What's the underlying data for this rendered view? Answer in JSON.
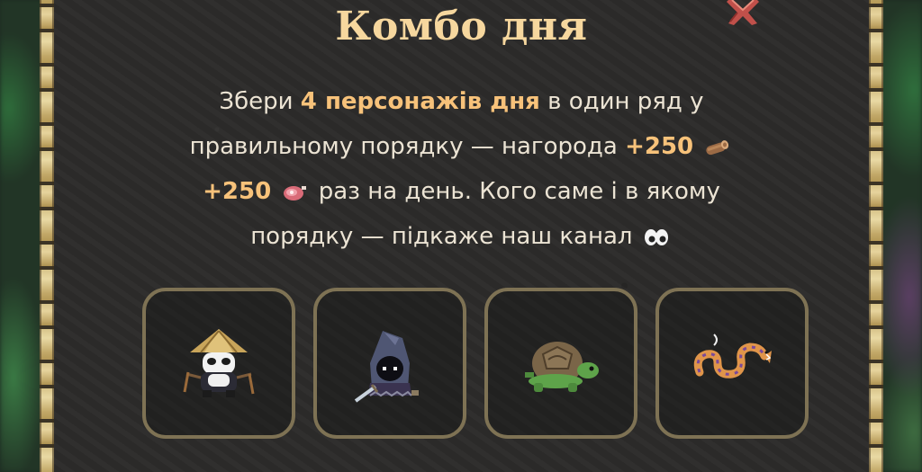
{
  "popup": {
    "title": "Комбо дня",
    "description": {
      "line1_a": "Збери",
      "line1_hl": "4 персонажів дня",
      "line1_b": "в один ряд у",
      "line2_a": "правильному порядку — нагорода",
      "reward1": "+250",
      "reward1_icon": "log-icon",
      "reward2": "+250",
      "reward2_icon": "meat-icon",
      "line3_b": "раз на день. Кого саме і в якому",
      "line4": "порядку — підкаже наш канал",
      "line4_icon": "eyes-icon"
    },
    "characters": [
      {
        "icon": "panda-monk-icon"
      },
      {
        "icon": "hooded-mage-icon"
      },
      {
        "icon": "turtle-icon"
      },
      {
        "icon": "snake-icon"
      }
    ]
  },
  "colors": {
    "title": "#f6d79e",
    "highlight": "#f7c27a",
    "text": "#ece4d4",
    "panel": "#2c2b2a",
    "slot_border": "#7e7254"
  }
}
